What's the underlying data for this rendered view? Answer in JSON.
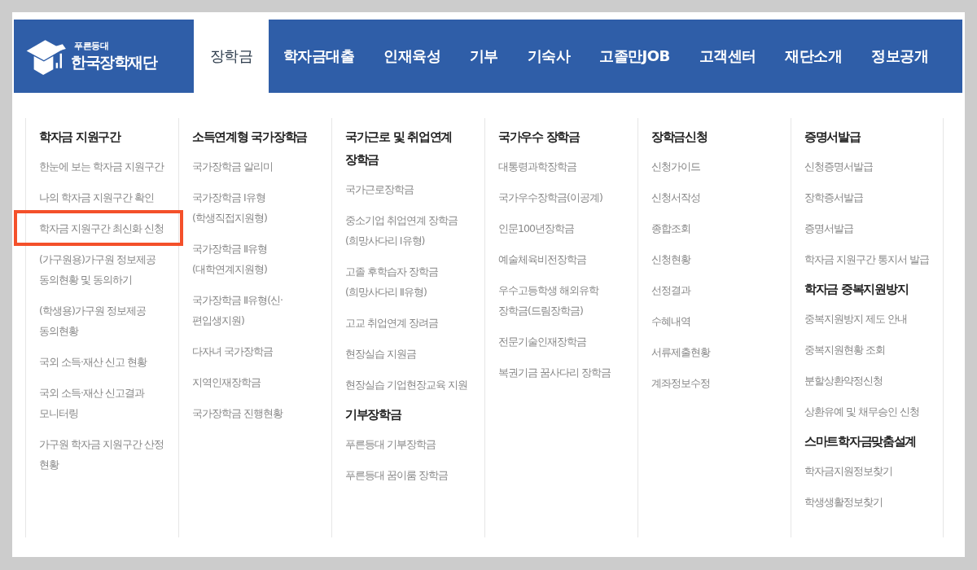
{
  "logo": {
    "tagline": "푸른등대",
    "name": "한국장학재단"
  },
  "nav": [
    {
      "label": "장학금",
      "selected": true
    },
    {
      "label": "학자금대출",
      "selected": false
    },
    {
      "label": "인재육성",
      "selected": false
    },
    {
      "label": "기부",
      "selected": false
    },
    {
      "label": "기숙사",
      "selected": false
    },
    {
      "label": "고졸만JOB",
      "selected": false
    },
    {
      "label": "고객센터",
      "selected": false
    },
    {
      "label": "재단소개",
      "selected": false
    },
    {
      "label": "정보공개",
      "selected": false
    }
  ],
  "columns": [
    {
      "sections": [
        {
          "title": "학자금 지원구간",
          "items": [
            {
              "text": "한눈에 보는 학자금 지원구간",
              "highlighted": false
            },
            {
              "text": "나의 학자금 지원구간 확인",
              "highlighted": false
            },
            {
              "text": "학자금 지원구간 최신화 신청",
              "highlighted": true
            },
            {
              "text": "(가구원용)가구원 정보제공 동의현황 및 동의하기",
              "highlighted": false
            },
            {
              "text": "(학생용)가구원 정보제공 동의현황",
              "highlighted": false
            },
            {
              "text": "국외 소득·재산 신고 현황",
              "highlighted": false
            },
            {
              "text": "국외 소득·재산 신고결과 모니터링",
              "highlighted": false
            },
            {
              "text": "가구원 학자금 지원구간 산정 현황",
              "highlighted": false
            }
          ]
        }
      ]
    },
    {
      "sections": [
        {
          "title": "소득연계형 국가장학금",
          "items": [
            {
              "text": "국가장학금 알리미",
              "highlighted": false
            },
            {
              "text": "국가장학금 Ⅰ유형 (학생직접지원형)",
              "highlighted": false
            },
            {
              "text": "국가장학금 Ⅱ유형 (대학연계지원형)",
              "highlighted": false
            },
            {
              "text": "국가장학금 Ⅱ유형(신·편입생지원)",
              "highlighted": false
            },
            {
              "text": "다자녀 국가장학금",
              "highlighted": false
            },
            {
              "text": "지역인재장학금",
              "highlighted": false
            },
            {
              "text": "국가장학금 진행현황",
              "highlighted": false
            }
          ]
        }
      ]
    },
    {
      "sections": [
        {
          "title": "국가근로 및 취업연계 장학금",
          "items": [
            {
              "text": "국가근로장학금",
              "highlighted": false
            },
            {
              "text": "중소기업 취업연계 장학금 (희망사다리 Ⅰ유형)",
              "highlighted": false
            },
            {
              "text": "고졸 후학습자 장학금 (희망사다리 Ⅱ유형)",
              "highlighted": false
            },
            {
              "text": "고교 취업연계 장려금",
              "highlighted": false
            },
            {
              "text": "현장실습 지원금",
              "highlighted": false
            },
            {
              "text": "현장실습 기업현장교육 지원",
              "highlighted": false
            }
          ]
        },
        {
          "title": "기부장학금",
          "items": [
            {
              "text": "푸른등대 기부장학금",
              "highlighted": false
            },
            {
              "text": "푸른등대 꿈이룸 장학금",
              "highlighted": false
            }
          ]
        }
      ]
    },
    {
      "sections": [
        {
          "title": "국가우수 장학금",
          "items": [
            {
              "text": "대통령과학장학금",
              "highlighted": false
            },
            {
              "text": "국가우수장학금(이공계)",
              "highlighted": false
            },
            {
              "text": "인문100년장학금",
              "highlighted": false
            },
            {
              "text": "예술체육비전장학금",
              "highlighted": false
            },
            {
              "text": "우수고등학생 해외유학 장학금(드림장학금)",
              "highlighted": false
            },
            {
              "text": "전문기술인재장학금",
              "highlighted": false
            },
            {
              "text": "복권기금 꿈사다리 장학금",
              "highlighted": false
            }
          ]
        }
      ]
    },
    {
      "sections": [
        {
          "title": "장학금신청",
          "items": [
            {
              "text": "신청가이드",
              "highlighted": false
            },
            {
              "text": "신청서작성",
              "highlighted": false
            },
            {
              "text": "종합조회",
              "highlighted": false
            },
            {
              "text": "신청현황",
              "highlighted": false
            },
            {
              "text": "선정결과",
              "highlighted": false
            },
            {
              "text": "수혜내역",
              "highlighted": false
            },
            {
              "text": "서류제출현황",
              "highlighted": false
            },
            {
              "text": "계좌정보수정",
              "highlighted": false
            }
          ]
        }
      ]
    },
    {
      "sections": [
        {
          "title": "증명서발급",
          "items": [
            {
              "text": "신청증명서발급",
              "highlighted": false
            },
            {
              "text": "장학증서발급",
              "highlighted": false
            },
            {
              "text": "증명서발급",
              "highlighted": false
            },
            {
              "text": "학자금 지원구간 통지서 발급",
              "highlighted": false
            }
          ]
        },
        {
          "title": "학자금 중복지원방지",
          "items": [
            {
              "text": "중복지원방지 제도 안내",
              "highlighted": false
            },
            {
              "text": "중복지원현황 조회",
              "highlighted": false
            },
            {
              "text": "분할상환약정신청",
              "highlighted": false
            },
            {
              "text": "상환유예 및 채무승인 신청",
              "highlighted": false
            }
          ]
        },
        {
          "title": "스마트학자금맞춤설계",
          "items": [
            {
              "text": "학자금지원정보찾기",
              "highlighted": false
            },
            {
              "text": "학생생활정보찾기",
              "highlighted": false
            }
          ]
        }
      ]
    }
  ]
}
